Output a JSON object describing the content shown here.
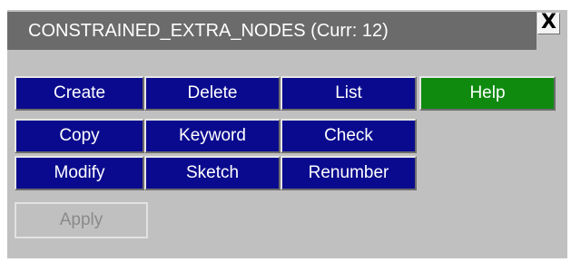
{
  "window": {
    "title": "CONSTRAINED_EXTRA_NODES (Curr: 12)",
    "close_glyph": "X"
  },
  "buttons": {
    "create": "Create",
    "delete": "Delete",
    "list": "List",
    "help": "Help",
    "copy": "Copy",
    "keyword": "Keyword",
    "check": "Check",
    "modify": "Modify",
    "sketch": "Sketch",
    "renumber": "Renumber",
    "apply": "Apply"
  },
  "colors": {
    "panel_bg": "#c0c0c0",
    "titlebar_bg": "#6b6b6b",
    "button_blue": "#0a0a8e",
    "button_green": "#0f8a0f",
    "disabled_text": "#8a8a8a"
  }
}
